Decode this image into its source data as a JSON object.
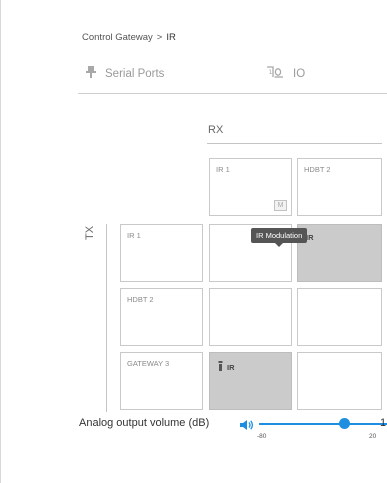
{
  "breadcrumb": {
    "parent": "Control Gateway",
    "separator": ">",
    "current": "IR"
  },
  "tabs": [
    {
      "label": "Serial Ports",
      "icon": "serial-port-icon"
    },
    {
      "label": "IO",
      "icon": "io-icon"
    }
  ],
  "matrix": {
    "rx_label": "RX",
    "tx_label": "TX",
    "rx_ports": [
      {
        "label": "IR 1",
        "badge": "M"
      },
      {
        "label": "HDBT 2"
      }
    ],
    "tx_ports": [
      {
        "label": "IR 1"
      },
      {
        "label": "HDBT 2"
      },
      {
        "label": "GATEWAY 3"
      }
    ],
    "cells": {
      "ir1_hdbt2": "IR",
      "gateway3_ir1": "IR"
    },
    "tooltip": "IR Modulation"
  },
  "volume": {
    "label": "Analog output volume (dB)",
    "min": "-80",
    "max": "20",
    "value": "1",
    "level_fraction": 0.85
  },
  "colors": {
    "accent": "#1e8fe0",
    "cell_active": "#cbcbcb"
  }
}
